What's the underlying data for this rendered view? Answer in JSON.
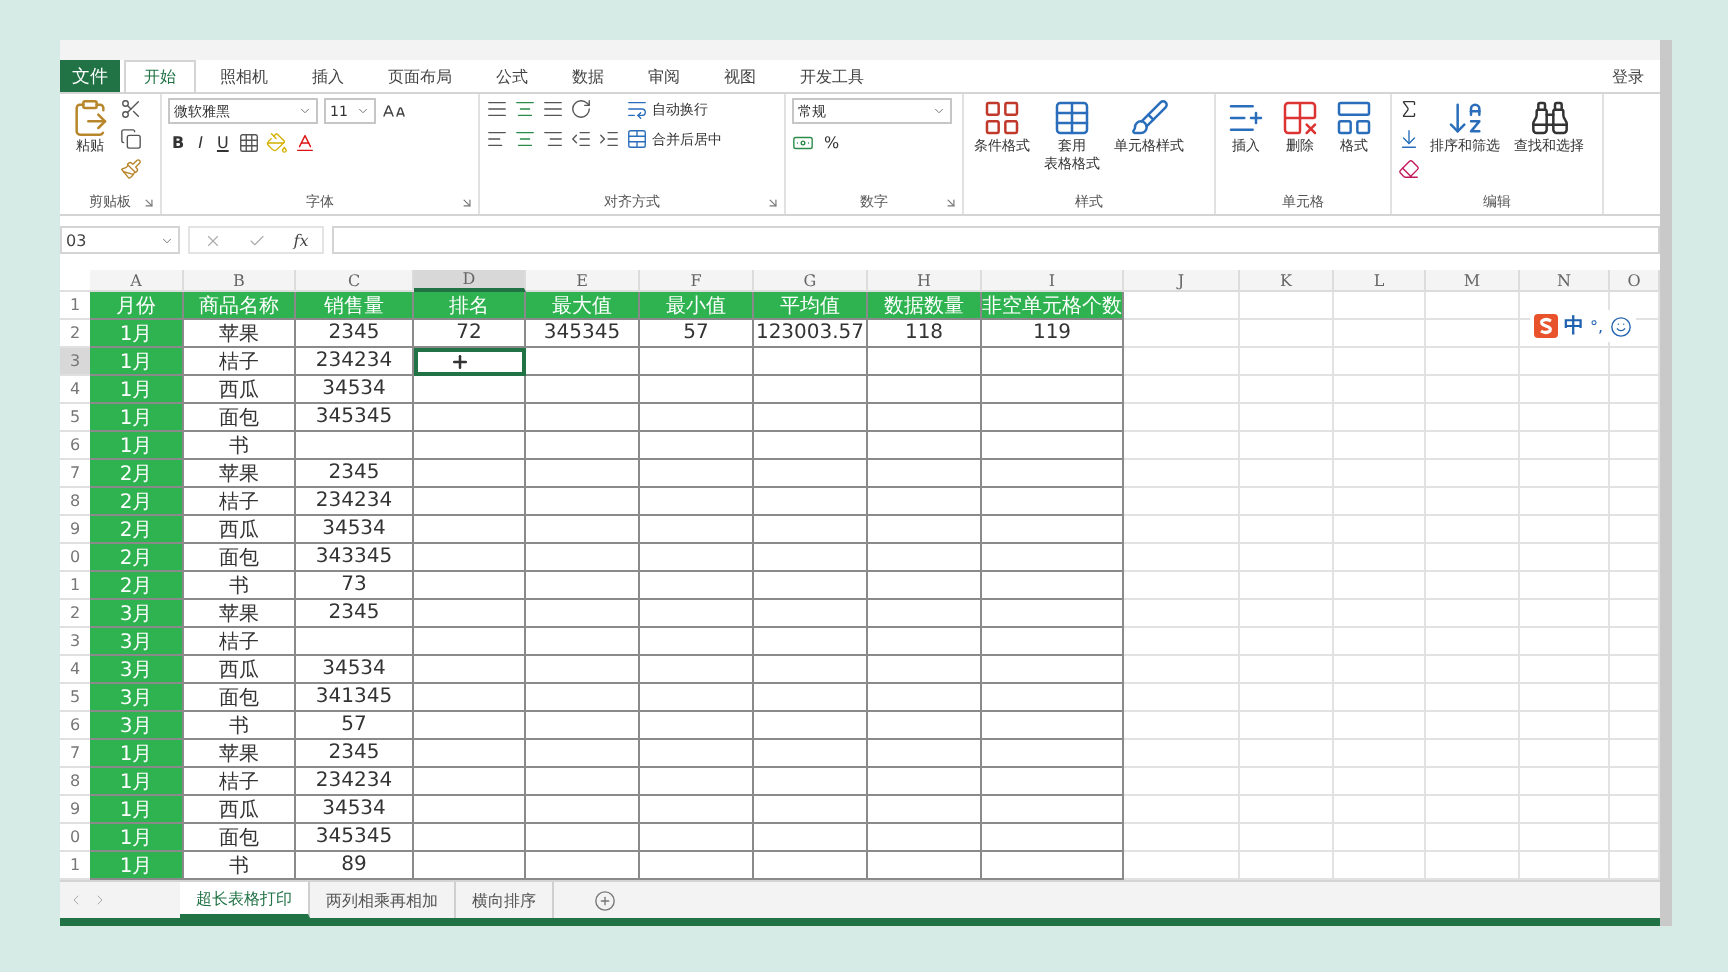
{
  "file_tab": {
    "label": "文件"
  },
  "ribbon_tabs": [
    {
      "label": "开始",
      "selected": true
    },
    {
      "label": "照相机",
      "selected": false
    },
    {
      "label": "插入",
      "selected": false
    },
    {
      "label": "页面布局",
      "selected": false
    },
    {
      "label": "公式",
      "selected": false
    },
    {
      "label": "数据",
      "selected": false
    },
    {
      "label": "审阅",
      "selected": false
    },
    {
      "label": "视图",
      "selected": false
    },
    {
      "label": "开发工具",
      "selected": false
    }
  ],
  "account": "登录",
  "ribbon_groups": [
    {
      "kind": "clipboard",
      "label": "剪贴板",
      "launcher": true,
      "paste": "粘贴"
    },
    {
      "kind": "font",
      "label": "字体",
      "launcher": true,
      "font": "微软雅黑",
      "size": "11",
      "bold": "B",
      "italic": "I",
      "underline": "U"
    },
    {
      "kind": "alignment",
      "label": "对齐方式",
      "launcher": true,
      "wrap": "自动换行",
      "merge": "合并后居中"
    },
    {
      "kind": "number",
      "label": "数字",
      "launcher": true,
      "format": "常规",
      "percent": "%"
    },
    {
      "kind": "buttons",
      "label": "样式",
      "buttons": [
        {
          "label": "条件格式"
        },
        {
          "label": "套用",
          "line2": "表格格式"
        },
        {
          "label": "单元格样式"
        }
      ]
    },
    {
      "kind": "buttons",
      "label": "单元格",
      "buttons": [
        {
          "label": "插入"
        },
        {
          "label": "删除"
        },
        {
          "label": "格式"
        }
      ]
    },
    {
      "kind": "editing",
      "label": "编辑",
      "buttons": [
        {
          "label": "排序和筛选"
        },
        {
          "label": "查找和选择"
        }
      ]
    }
  ],
  "formula_bar": {
    "name_box": "03",
    "function_label": "fx"
  },
  "columns": [
    {
      "letter": "A",
      "selected": false,
      "filled": true
    },
    {
      "letter": "B",
      "selected": false,
      "filled": false
    },
    {
      "letter": "C",
      "selected": false,
      "filled": false
    },
    {
      "letter": "D",
      "selected": true,
      "filled": false
    },
    {
      "letter": "E",
      "selected": false,
      "filled": false
    },
    {
      "letter": "F",
      "selected": false,
      "filled": false
    },
    {
      "letter": "G",
      "selected": false,
      "filled": false
    },
    {
      "letter": "H",
      "selected": false,
      "filled": false
    },
    {
      "letter": "I",
      "selected": false,
      "filled": false
    },
    {
      "letter": "J",
      "selected": false,
      "filled": false
    },
    {
      "letter": "K",
      "selected": false,
      "filled": false
    },
    {
      "letter": "L",
      "selected": false,
      "filled": false
    },
    {
      "letter": "M",
      "selected": false,
      "filled": false
    },
    {
      "letter": "N",
      "selected": false,
      "filled": false
    },
    {
      "letter": "O",
      "selected": false,
      "filled": false
    }
  ],
  "rows": [
    {
      "number": "1",
      "kind": "header",
      "selected": false,
      "cells": [
        "月份",
        "商品名称",
        "销售量",
        "排名",
        "最大值",
        "最小值",
        "平均值",
        "数据数量",
        "非空单元格个数"
      ]
    },
    {
      "number": "2",
      "kind": "data",
      "selected": false,
      "cells": [
        "1月",
        "苹果",
        "2345",
        "72",
        "345345",
        "57",
        "123003.57",
        "118",
        "119"
      ]
    },
    {
      "number": "3",
      "kind": "data",
      "selected": true,
      "cells": [
        "1月",
        "桔子",
        "234234"
      ]
    },
    {
      "number": "4",
      "kind": "data",
      "selected": false,
      "cells": [
        "1月",
        "西瓜",
        "34534"
      ]
    },
    {
      "number": "5",
      "kind": "data",
      "selected": false,
      "cells": [
        "1月",
        "面包",
        "345345"
      ]
    },
    {
      "number": "6",
      "kind": "data",
      "selected": false,
      "cells": [
        "1月",
        "书",
        null
      ]
    },
    {
      "number": "7",
      "kind": "data",
      "selected": false,
      "cells": [
        "2月",
        "苹果",
        "2345"
      ]
    },
    {
      "number": "8",
      "kind": "data",
      "selected": false,
      "cells": [
        "2月",
        "桔子",
        "234234"
      ]
    },
    {
      "number": "9",
      "kind": "data",
      "selected": false,
      "cells": [
        "2月",
        "西瓜",
        "34534"
      ]
    },
    {
      "number": "0",
      "kind": "data",
      "selected": false,
      "cells": [
        "2月",
        "面包",
        "343345"
      ]
    },
    {
      "number": "1",
      "kind": "data",
      "selected": false,
      "cells": [
        "2月",
        "书",
        "73"
      ]
    },
    {
      "number": "2",
      "kind": "data",
      "selected": false,
      "cells": [
        "3月",
        "苹果",
        "2345"
      ]
    },
    {
      "number": "3",
      "kind": "data",
      "selected": false,
      "cells": [
        "3月",
        "桔子",
        null
      ]
    },
    {
      "number": "4",
      "kind": "data",
      "selected": false,
      "cells": [
        "3月",
        "西瓜",
        "34534"
      ]
    },
    {
      "number": "5",
      "kind": "data",
      "selected": false,
      "cells": [
        "3月",
        "面包",
        "341345"
      ]
    },
    {
      "number": "6",
      "kind": "data",
      "selected": false,
      "cells": [
        "3月",
        "书",
        "57"
      ]
    },
    {
      "number": "7",
      "kind": "data",
      "selected": false,
      "cells": [
        "1月",
        "苹果",
        "2345"
      ]
    },
    {
      "number": "8",
      "kind": "data",
      "selected": false,
      "cells": [
        "1月",
        "桔子",
        "234234"
      ]
    },
    {
      "number": "9",
      "kind": "data",
      "selected": false,
      "cells": [
        "1月",
        "西瓜",
        "34534"
      ]
    },
    {
      "number": "0",
      "kind": "data",
      "selected": false,
      "cells": [
        "1月",
        "面包",
        "345345"
      ]
    },
    {
      "number": "1",
      "kind": "data",
      "selected": false,
      "cells": [
        "1月",
        "书",
        "89"
      ]
    }
  ],
  "ime_toolbar": {
    "mode": "中",
    "punctuation": "°,"
  },
  "sheet_tabs": [
    {
      "label": "超长表格打印",
      "selected": true
    },
    {
      "label": "两列相乘再相加",
      "selected": false
    },
    {
      "label": "横向排序",
      "selected": false
    }
  ]
}
